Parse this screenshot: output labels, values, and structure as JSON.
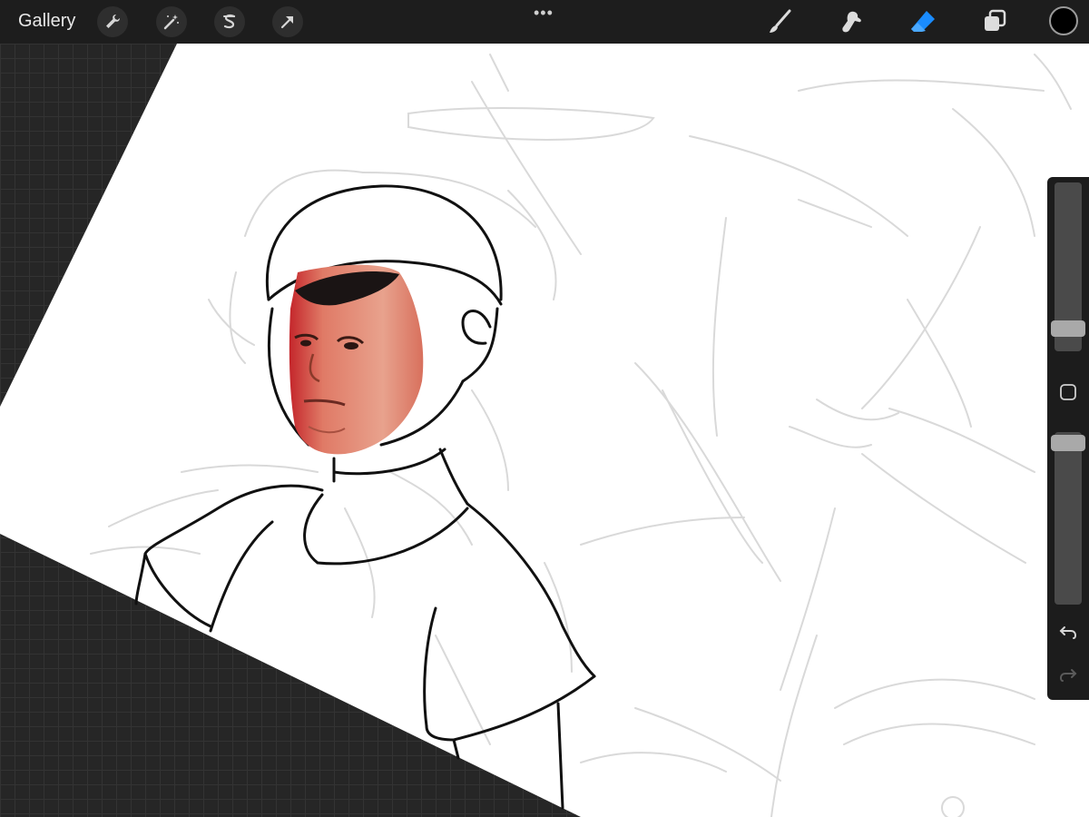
{
  "topbar": {
    "gallery_label": "Gallery",
    "more_glyph": "•••",
    "left_tools": [
      "wrench-icon",
      "magic-wand-icon",
      "selection-s-icon",
      "transform-arrow-icon"
    ],
    "right_tools": [
      "brush-icon",
      "smudge-icon",
      "eraser-icon",
      "layers-icon"
    ],
    "active_tool": "eraser",
    "accent_color": "#1a8cff",
    "current_color": "#000000"
  },
  "sidebar": {
    "brush_size_level": 0.82,
    "opacity_level": 0.98,
    "controls": [
      "brush-size-slider",
      "modify-button",
      "opacity-slider",
      "undo-icon",
      "redo-icon"
    ]
  },
  "canvas": {
    "paper_color": "#ffffff",
    "sketch_color": "#d8d8d8",
    "line_color": "#111111"
  }
}
